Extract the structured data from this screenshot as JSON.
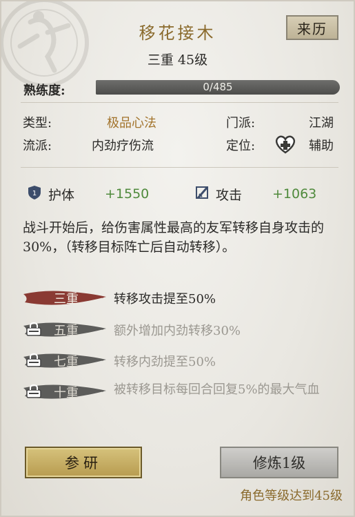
{
  "header": {
    "title": "移花接木",
    "level": "三重 45级",
    "origin_button": "来历"
  },
  "proficiency": {
    "label": "熟练度:",
    "text": "0/485",
    "value": 0,
    "max": 485
  },
  "info": {
    "type_label": "类型:",
    "type_value": "极品心法",
    "school_label": "门派:",
    "school_value": "江湖",
    "style_label": "流派:",
    "style_value": "内劲疗伤流",
    "role_label": "定位:",
    "role_value": "辅助"
  },
  "stats": {
    "defense_label": "护体",
    "defense_value": "+1550",
    "attack_label": "攻击",
    "attack_value": "+1063"
  },
  "description": "战斗开始后，给伤害属性最高的友军转移自身攻击的30%，（转移目标阵亡后自动转移）。",
  "tiers": [
    {
      "name": "三重",
      "desc": "转移攻击提至50%",
      "unlocked": true
    },
    {
      "name": "五重",
      "desc": "额外增加内劲转移30%",
      "unlocked": false
    },
    {
      "name": "七重",
      "desc": "转移内劲提至50%",
      "unlocked": false
    },
    {
      "name": "十重",
      "desc": "被转移目标每回合回复5%的最大气血",
      "unlocked": false
    }
  ],
  "buttons": {
    "research": "参研",
    "cultivate": "修炼1级"
  },
  "requirement": "角色等级达到45级",
  "colors": {
    "gold": "#a2732b",
    "green": "#4f8a3c",
    "unlocked_brush": "#8a3a33",
    "locked_brush": "#5c5c5a"
  },
  "icons": {
    "defense": "shield-icon",
    "attack": "sword-icon",
    "role": "heart-cross-icon",
    "lock": "lock-icon"
  }
}
